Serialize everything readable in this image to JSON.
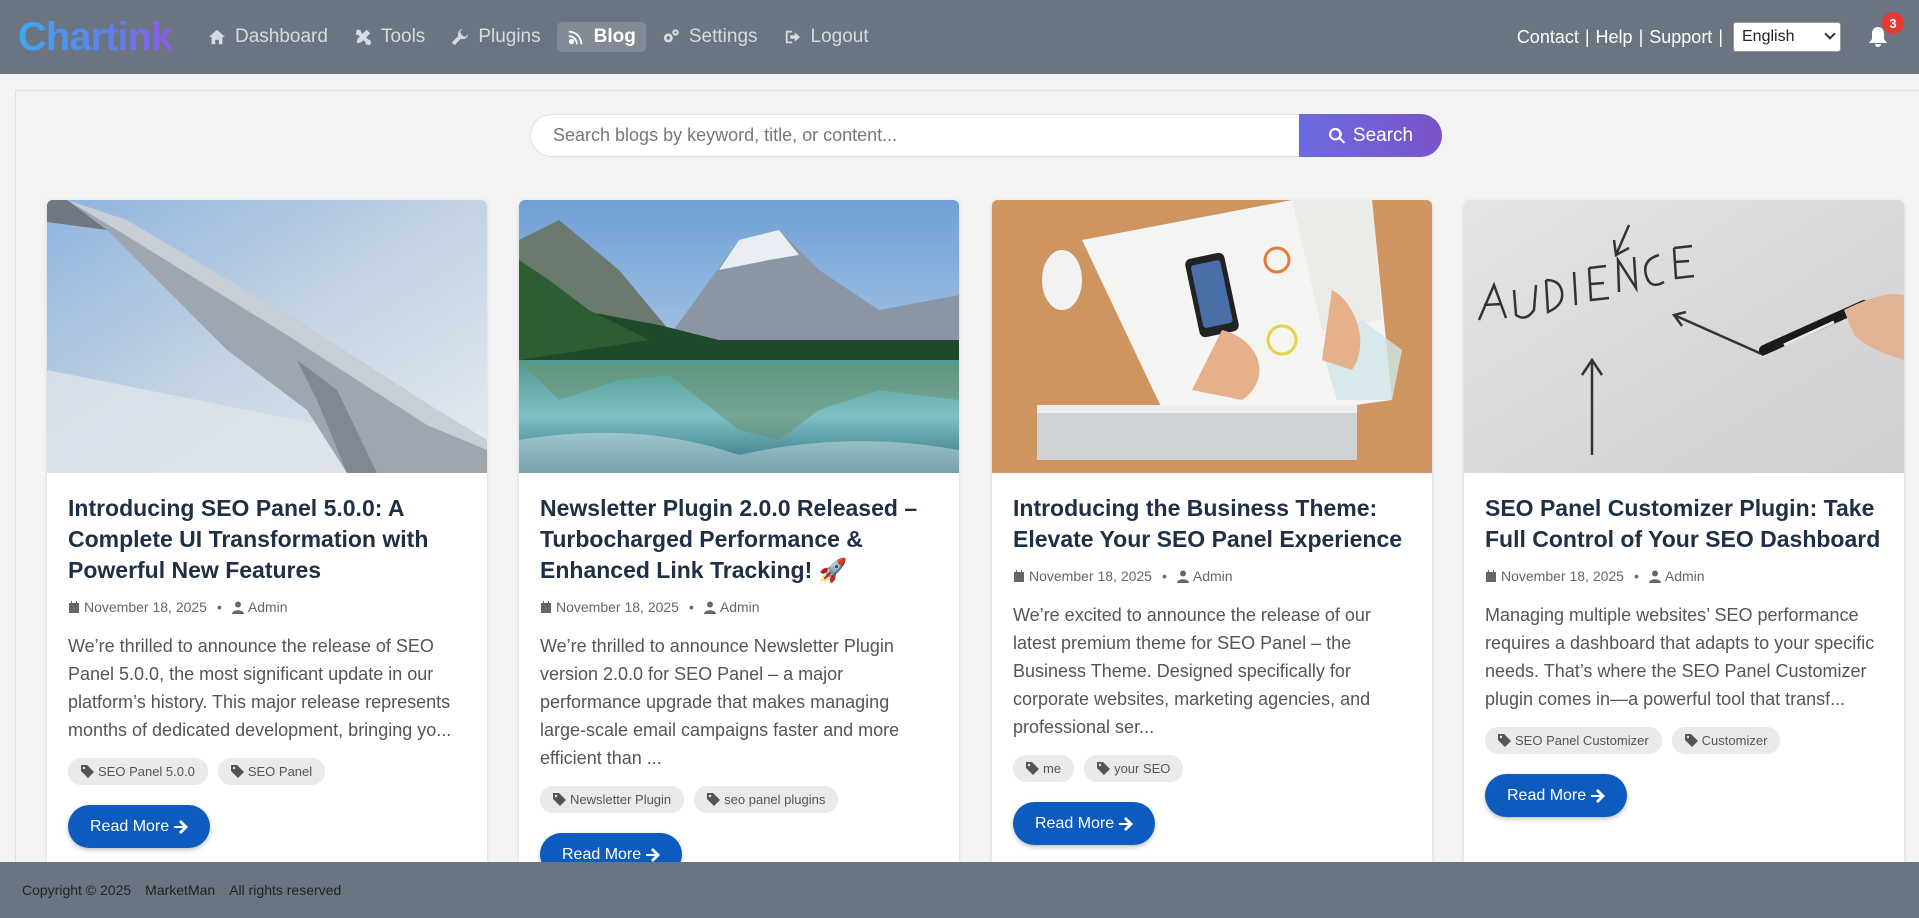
{
  "brand": {
    "name": "Chartink"
  },
  "nav": {
    "items": [
      {
        "label": "Dashboard",
        "icon": "home-icon"
      },
      {
        "label": "Tools",
        "icon": "tools-icon"
      },
      {
        "label": "Plugins",
        "icon": "wrench-icon"
      },
      {
        "label": "Blog",
        "icon": "blog-icon",
        "active": true
      },
      {
        "label": "Settings",
        "icon": "gears-icon"
      },
      {
        "label": "Logout",
        "icon": "logout-icon"
      }
    ],
    "right": {
      "contact": "Contact",
      "help": "Help",
      "support": "Support",
      "separator": "|"
    },
    "language": "English",
    "notifications_count": "3"
  },
  "search": {
    "placeholder": "Search blogs by keyword, title, or content...",
    "value": "",
    "button_label": "Search"
  },
  "posts": [
    {
      "title": "Introducing SEO Panel 5.0.0: A Complete UI Transformation with Powerful New Features",
      "date": "November 18, 2025",
      "author": "Admin",
      "excerpt": "We’re thrilled to announce the release of SEO Panel 5.0.0, the most significant update in our platform’s history. This major release represents months of dedicated development, bringing yo...",
      "tags": [
        "SEO Panel 5.0.0",
        "SEO Panel"
      ],
      "read_more": "Read More",
      "image": "airplane-wing-photo"
    },
    {
      "title": "Newsletter Plugin 2.0.0 Released – Turbocharged Performance & Enhanced Link Tracking! 🚀",
      "date": "November 18, 2025",
      "author": "Admin",
      "excerpt": "We’re thrilled to announce Newsletter Plugin version 2.0.0 for SEO Panel – a major performance upgrade that makes managing large-scale email  campaigns faster and more efficient than ...",
      "tags": [
        "Newsletter Plugin",
        "seo panel plugins"
      ],
      "read_more": "Read More",
      "image": "mountain-lake-photo"
    },
    {
      "title": "Introducing the Business Theme: Elevate Your SEO Panel Experience",
      "date": "November 18, 2025",
      "author": "Admin",
      "excerpt": "We’re excited to announce the release of our latest premium theme for SEO Panel – the Business Theme. Designed specifically for corporate websites, marketing agencies, and professional ser...",
      "tags": [
        "me",
        "your SEO"
      ],
      "read_more": "Read More",
      "image": "desk-workspace-photo"
    },
    {
      "title": "SEO Panel Customizer Plugin: Take Full Control of Your SEO Dashboard",
      "date": "November 18, 2025",
      "author": "Admin",
      "excerpt": "Managing multiple websites’ SEO performance requires a dashboard that adapts to your specific needs. That’s where the SEO Panel Customizer plugin comes in—a powerful tool that transf...",
      "tags": [
        "SEO Panel Customizer",
        "Customizer"
      ],
      "read_more": "Read More",
      "image": "audience-whiteboard-photo"
    }
  ],
  "footer": {
    "copyright": "Copyright © 2025",
    "company": "MarketMan",
    "rights": "All rights reserved"
  }
}
